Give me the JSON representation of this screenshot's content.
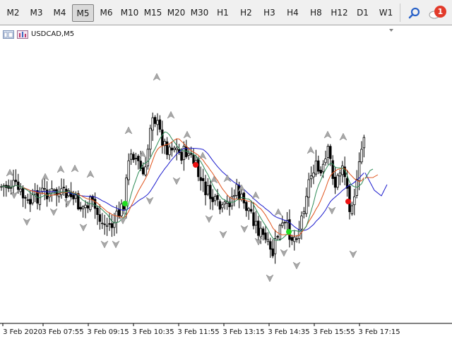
{
  "toolbar": {
    "timeframes": [
      "M2",
      "M3",
      "M4",
      "M5",
      "M6",
      "M10",
      "M15",
      "M20",
      "M30",
      "H1",
      "H2",
      "H3",
      "H4",
      "H8",
      "H12",
      "D1",
      "W1"
    ],
    "active_timeframe": "M5",
    "notification_count": "1"
  },
  "chart": {
    "symbol_label": "USDCAD,M5",
    "x_labels": [
      "3 Feb 2020",
      "3 Feb 07:55",
      "3 Feb 09:15",
      "3 Feb 10:35",
      "3 Feb 11:55",
      "3 Feb 13:15",
      "3 Feb 14:35",
      "3 Feb 15:55",
      "3 Feb 17:15"
    ],
    "colors": {
      "candle": "#000000",
      "ma_fast": "#2e8b57",
      "ma_medium": "#e0521a",
      "ma_slow": "#1a1acd",
      "signal_buy": "#22dd22",
      "signal_sell": "#ee1111",
      "fractal": "#a8a8a8"
    }
  }
}
